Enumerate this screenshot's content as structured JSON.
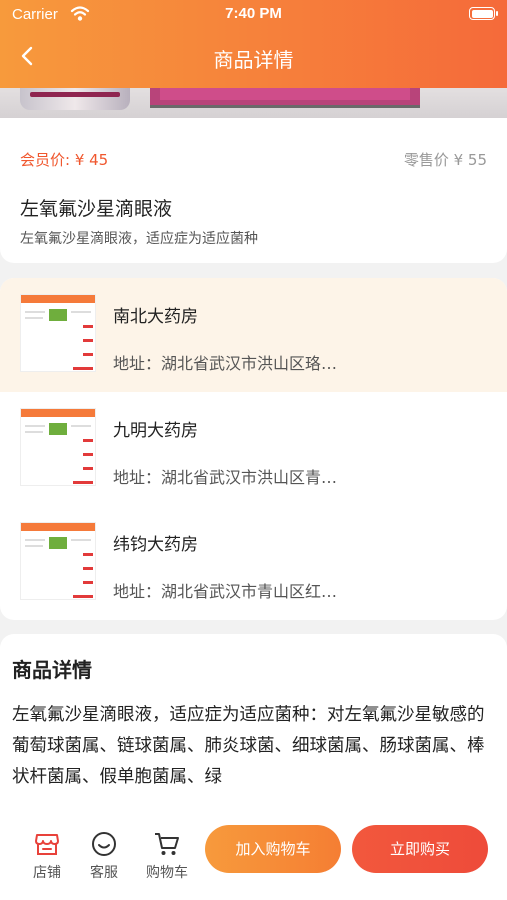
{
  "status_bar": {
    "carrier": "Carrier",
    "time": "7:40 PM"
  },
  "nav": {
    "title": "商品详情"
  },
  "product": {
    "member_price": "会员价: ¥ 45",
    "retail_price": "零售价 ¥ 55",
    "name": "左氧氟沙星滴眼液",
    "subtitle": "左氧氟沙星滴眼液，适应症为适应菌种"
  },
  "stores": [
    {
      "name": "南北大药房",
      "address": "地址：湖北省武汉市洪山区珞…",
      "selected": true
    },
    {
      "name": "九明大药房",
      "address": "地址：湖北省武汉市洪山区青…",
      "selected": false
    },
    {
      "name": "纬钧大药房",
      "address": "地址：湖北省武汉市青山区红…",
      "selected": false
    }
  ],
  "details": {
    "title": "商品详情",
    "text": "左氧氟沙星滴眼液，适应症为适应菌种：对左氧氟沙星敏感的葡萄球菌属、链球菌属、肺炎球菌、细球菌属、肠球菌属、棒状杆菌属、假单胞菌属、绿"
  },
  "bottom_bar": {
    "tabs": [
      {
        "label": "店铺",
        "icon": "store-icon"
      },
      {
        "label": "客服",
        "icon": "customer-service-icon"
      },
      {
        "label": "购物车",
        "icon": "cart-icon"
      }
    ],
    "add_to_cart": "加入购物车",
    "buy_now": "立即购买"
  },
  "colors": {
    "accent": "#f56a3a",
    "accent_light": "#f79a3c",
    "price": "#f0572e",
    "selected_bg": "#fdf4e8"
  }
}
